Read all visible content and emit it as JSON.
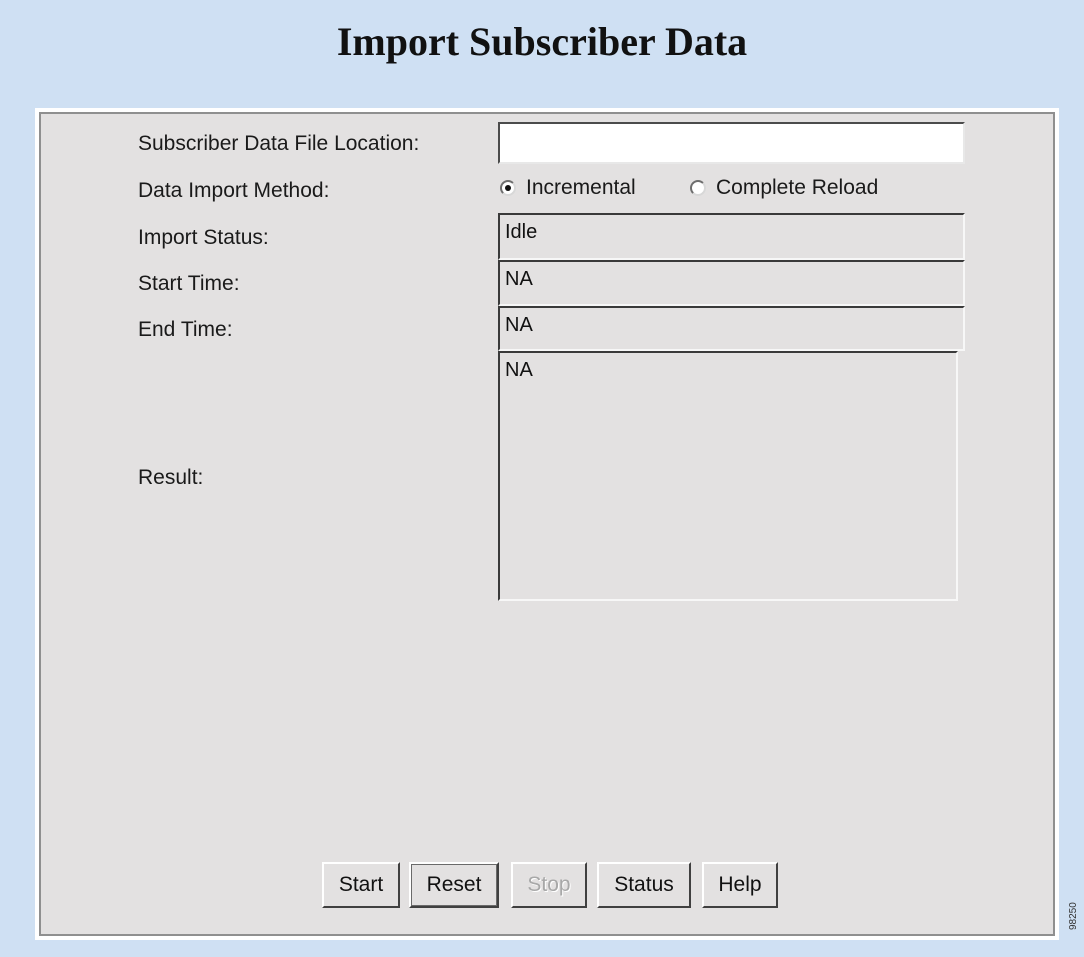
{
  "title": "Import Subscriber Data",
  "form": {
    "file_location": {
      "label": "Subscriber Data File Location:",
      "value": ""
    },
    "import_method": {
      "label": "Data Import Method:",
      "options": [
        {
          "label": "Incremental",
          "checked": true
        },
        {
          "label": "Complete Reload",
          "checked": false
        }
      ]
    },
    "import_status": {
      "label": "Import Status:",
      "value": "Idle"
    },
    "start_time": {
      "label": "Start Time:",
      "value": "NA"
    },
    "end_time": {
      "label": "End Time:",
      "value": "NA"
    },
    "result": {
      "label": "Result:",
      "value": "NA"
    }
  },
  "buttons": {
    "start": "Start",
    "reset": "Reset",
    "stop": "Stop",
    "status": "Status",
    "help": "Help"
  },
  "figure_id": "98250"
}
